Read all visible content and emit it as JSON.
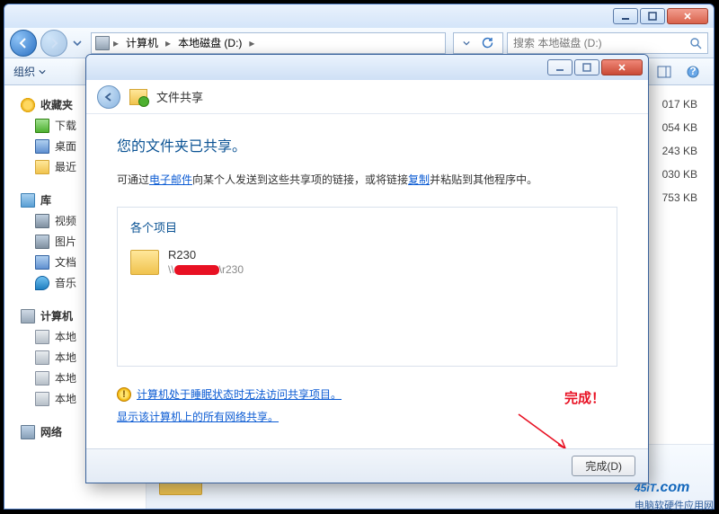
{
  "explorer": {
    "breadcrumb": {
      "seg1": "计算机",
      "seg2": "本地磁盘 (D:)"
    },
    "search_placeholder": "搜索 本地磁盘 (D:)",
    "toolbar": {
      "organize": "组织"
    },
    "sidebar": {
      "favorites": {
        "header": "收藏夹",
        "downloads": "下载",
        "desktop": "桌面",
        "recent": "最近"
      },
      "libraries": {
        "header": "库",
        "video": "视频",
        "pictures": "图片",
        "documents": "文档",
        "music": "音乐"
      },
      "computer": {
        "header": "计算机",
        "drive_c": "本地",
        "drive_d": "本地",
        "drive_e": "本地",
        "drive_f": "本地"
      },
      "network": {
        "header": "网络"
      }
    },
    "sizes": [
      "017 KB",
      "054 KB",
      "243 KB",
      "030 KB",
      "753 KB"
    ]
  },
  "dialog": {
    "title": "文件共享",
    "headline": "您的文件夹已共享。",
    "subtext_pre": "可通过",
    "subtext_link1": "电子邮件",
    "subtext_mid": "向某个人发送到这些共享项的链接，或将链接",
    "subtext_link2": "复制",
    "subtext_post": "并粘贴到其他程序中。",
    "items_label": "各个项目",
    "item": {
      "name": "R230",
      "path_prefix": "\\\\",
      "path_suffix": "\\r230"
    },
    "warn_text": "计算机处于睡眠状态时无法访问共享项目。",
    "secondary_link": "显示该计算机上的所有网络共享。",
    "done_button": "完成(D)",
    "annotation": "完成！"
  },
  "watermark": {
    "brand": "45iT",
    "dot": ".com",
    "sub": "电脑软硬件应用网"
  }
}
